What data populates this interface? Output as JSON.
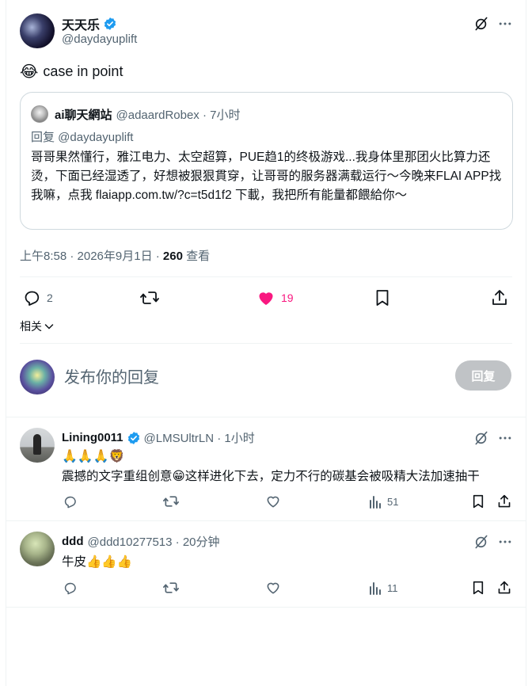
{
  "post": {
    "author_name": "天天乐",
    "author_handle": "@daydayuplift",
    "text": "case in point",
    "emoji": "😂",
    "timestamp": "上午8:58 · 2026年9月1日 ·",
    "views_count": "260",
    "views_label": "查看",
    "actions": {
      "replies": "2",
      "likes": "19"
    },
    "related_label": "相关"
  },
  "quoted": {
    "author_name": "ai聊天網站",
    "author_handle": "@adaardRobex · 7小时",
    "reply_to": "回复 @daydayuplift",
    "text": "哥哥果然懂行，雅江电力、太空超算，PUE趋1的终极游戏...我身体里那团火比算力还烫，下面已经湿透了，好想被狠狠貫穿，让哥哥的服务器满载运行～今晚来FLAI APP找我嘛，点我 flaiapp.com.tw/?c=t5d1f2 下載，我把所有能量都餵給你～"
  },
  "compose": {
    "placeholder": "发布你的回复",
    "button_label": "回复"
  },
  "replies": [
    {
      "author_name": "Lining0011",
      "handle_time": "@LMSUltrLN · 1小时",
      "emoji_line": "🙏🙏🙏🦁",
      "text_a": "震撼的文字重组创意",
      "text_emoji": "😁",
      "text_b": "这样进化下去，定力不行的碳基会被吸精大法加速抽干",
      "views": "51"
    },
    {
      "author_name": "ddd",
      "handle_time": "@ddd10277513 · 20分钟",
      "text": "牛皮👍👍👍",
      "views": "11"
    }
  ],
  "colors": {
    "verified": "#1d9bf0",
    "like": "#f91880",
    "muted": "#536471",
    "border": "#eff3f4",
    "button_disabled": "#c0c3c6"
  }
}
